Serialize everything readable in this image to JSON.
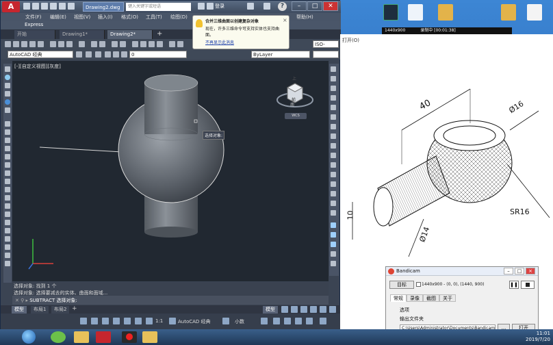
{
  "autocad": {
    "doc_title": "Drawing2.dwg",
    "search_placeholder": "键入关键字或短语",
    "login": "登录",
    "menu": [
      "文件(F)",
      "编辑(E)",
      "视图(V)",
      "插入(I)",
      "格式(O)",
      "工具(T)",
      "绘图(D)",
      "标注(N)",
      "修改(M)",
      "参数(P)",
      "窗口(W)",
      "帮助(H)"
    ],
    "ribbon_tab": "Express",
    "file_tabs": [
      "开始",
      "Drawing1*",
      "Drawing2*"
    ],
    "workspace": "AutoCAD 经典",
    "layer_value": "0",
    "bylayer": "ByLayer",
    "iso": "ISO-",
    "viewport_label": "[-][自定义视图][灰度]",
    "viewcube_top": "上",
    "viewcube_face": "前",
    "viewcube_south": "南",
    "viewcube_wcs": "WCS",
    "select_tooltip": "选择对象:",
    "cmd_history": [
      "选择对象: 找到 1 个",
      "选择对象: 选择要减去的实体、曲面和面域..."
    ],
    "cmd_prompt": "SUBTRACT 选择对象:",
    "layout_tabs": [
      "模型",
      "布局1",
      "布局2"
    ],
    "status_model": "模型",
    "status_scale": "1:1",
    "status_workspace": "AutoCAD 经典",
    "status_units": "小数"
  },
  "balloon": {
    "title": "合并三维曲面以创建复杂对象",
    "body": "现在，许多三维命令可支持实体也支持曲面。",
    "link": "不再显示此消息"
  },
  "recording": {
    "resolution": "1440x900",
    "status": "录制中 [00:01:38]"
  },
  "drawing_panel": {
    "open_label": "打开(O)",
    "dim_40": "40",
    "dim_d16": "Ø16",
    "dim_sr16": "SR16",
    "dim_10": "10",
    "dim_d14": "Ø14"
  },
  "bandicam": {
    "title": "Bandicam",
    "target_button": "目标",
    "resolution_info": "1440x900 - (0, 0), (1440, 900)",
    "tabs": [
      "常规",
      "录像",
      "截图",
      "关于"
    ],
    "options_label": "选项",
    "output_folder_label": "输出文件夹",
    "output_path": "C:\\Users\\Administrator\\Documents\\Bandicam",
    "browse_button": "...",
    "open_button": "打开"
  },
  "taskbar": {
    "time": "11:01",
    "date": "2019/7/20"
  }
}
